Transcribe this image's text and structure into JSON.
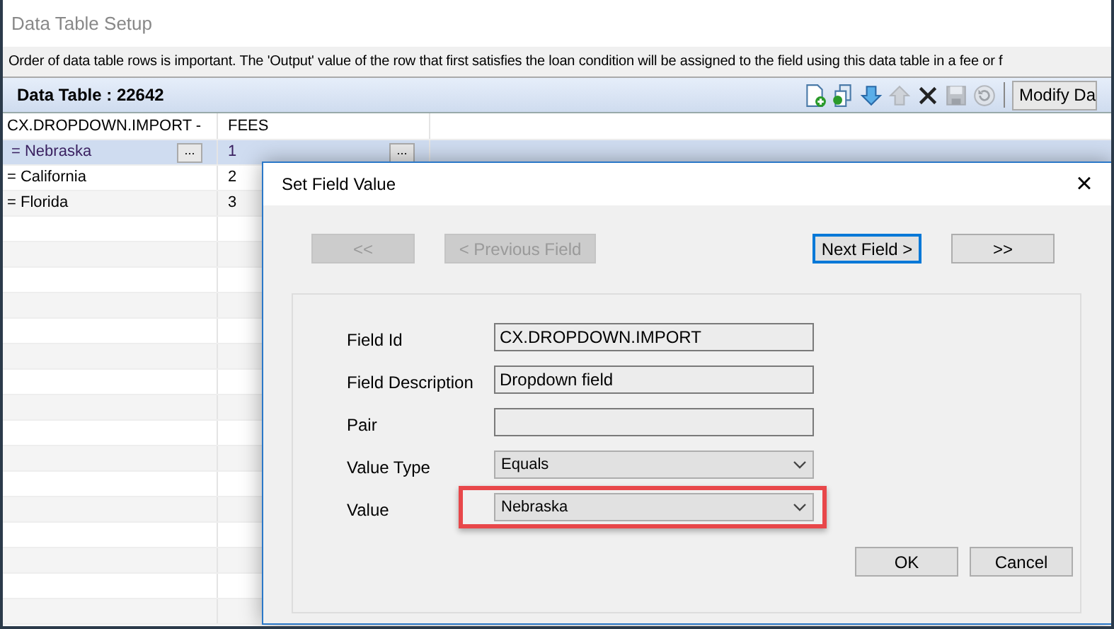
{
  "window": {
    "title": "Data Table Setup"
  },
  "info_bar": {
    "text": "Order of data table rows is important. The 'Output' value of the row that first satisfies the loan condition will be assigned to the field using this data table in a fee or f"
  },
  "toolbar": {
    "title": "Data Table : 22642",
    "tools": [
      {
        "kind": "add"
      },
      {
        "kind": "copy"
      },
      {
        "kind": "down"
      },
      {
        "kind": "up",
        "disabled": true
      },
      {
        "kind": "delete"
      },
      {
        "kind": "save",
        "disabled": true
      },
      {
        "kind": "reset",
        "disabled": true
      }
    ],
    "button": "Modify Da"
  },
  "table": {
    "columns": [
      "CX.DROPDOWN.IMPORT -",
      "FEES"
    ],
    "rows": [
      {
        "cells": [
          "= Nebraska",
          "1"
        ],
        "selected": true,
        "cell_button": "..."
      },
      {
        "cells": [
          "= California",
          "2"
        ],
        "selected": false
      },
      {
        "cells": [
          "= Florida",
          "3"
        ],
        "selected": false
      }
    ]
  },
  "dialog": {
    "title": "Set Field Value",
    "close": "×",
    "nav_buttons": [
      {
        "label": "<<",
        "disabled": true,
        "focused": false
      },
      {
        "label": "< Previous Field",
        "disabled": true,
        "focused": false
      },
      {
        "label": "Next Field >",
        "disabled": false,
        "focused": true
      },
      {
        "label": ">>",
        "disabled": false,
        "focused": false
      }
    ],
    "fields": [
      {
        "label": "Field Id",
        "kind": "text",
        "value": "CX.DROPDOWN.IMPORT",
        "highlighted": false
      },
      {
        "label": "Field Description",
        "kind": "text",
        "value": "Dropdown field",
        "highlighted": false
      },
      {
        "label": "Pair",
        "kind": "text",
        "highlighted": false
      },
      {
        "label": "Value Type",
        "kind": "dropdown",
        "value": "Equals",
        "highlighted": false
      },
      {
        "label": "Value",
        "kind": "dropdown",
        "value": "Nebraska",
        "highlighted": true
      }
    ],
    "buttons": [
      "OK",
      "Cancel"
    ]
  }
}
